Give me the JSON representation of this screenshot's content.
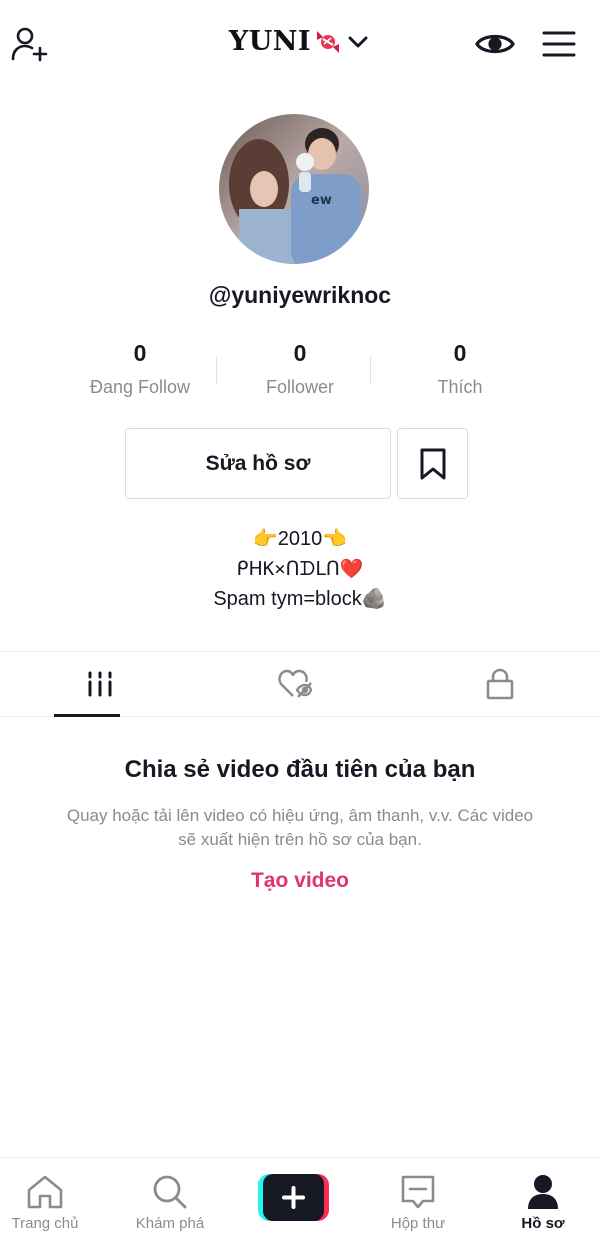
{
  "header": {
    "title": "YUNI",
    "add_user_icon": "add-user-icon",
    "eye_icon": "eye-icon",
    "menu_icon": "menu-icon"
  },
  "profile": {
    "username": "@yuniyewriknoc",
    "stats": [
      {
        "value": "0",
        "label": "Đang Follow"
      },
      {
        "value": "0",
        "label": "Follower"
      },
      {
        "value": "0",
        "label": "Thích"
      }
    ],
    "edit_button": "Sửa hồ sơ",
    "bio": [
      "👉2010👈",
      "ᑭᕼK×ᑎᗪᒪᑎ❤️",
      "Spam tym=block🪨"
    ]
  },
  "tabs": [
    {
      "icon": "grid-videos-icon",
      "active": true
    },
    {
      "icon": "liked-hidden-icon",
      "active": false
    },
    {
      "icon": "lock-icon",
      "active": false
    }
  ],
  "empty_state": {
    "title": "Chia sẻ video đầu tiên của bạn",
    "description": "Quay hoặc tải lên video có hiệu ứng, âm thanh, v.v. Các video sẽ xuất hiện trên hồ sơ của bạn.",
    "action": "Tạo video"
  },
  "bottom_nav": [
    {
      "label": "Trang chủ",
      "icon": "home-icon",
      "active": false
    },
    {
      "label": "Khám phá",
      "icon": "search-icon",
      "active": false
    },
    {
      "label": "",
      "icon": "plus-icon",
      "active": false
    },
    {
      "label": "Hộp thư",
      "icon": "inbox-icon",
      "active": false
    },
    {
      "label": "Hồ sơ",
      "icon": "profile-icon",
      "active": true
    }
  ],
  "colors": {
    "accent": "#e2336b",
    "text_primary": "#161823",
    "text_secondary": "#8a8b91",
    "create_cyan": "#25f4ee",
    "create_red": "#fe2c55"
  }
}
